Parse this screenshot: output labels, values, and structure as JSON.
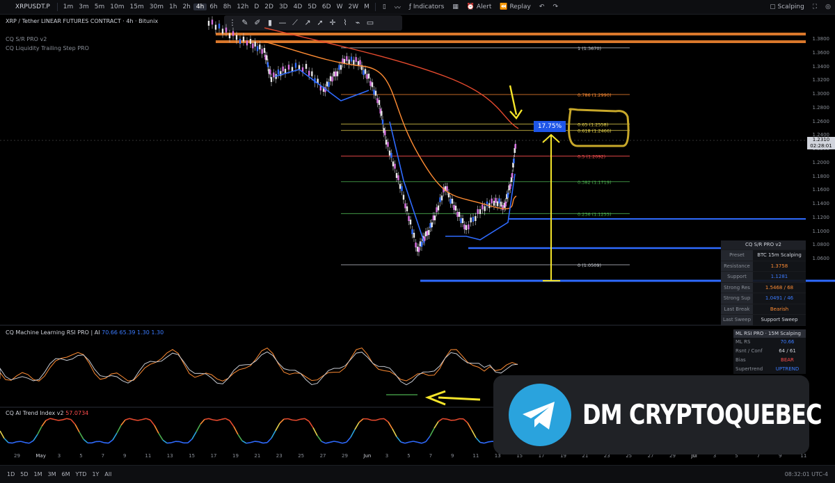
{
  "toolbar": {
    "symbol": "XRPUSDT.P",
    "timeframes": [
      "1m",
      "3m",
      "5m",
      "10m",
      "15m",
      "30m",
      "1h",
      "2h",
      "4h",
      "6h",
      "8h",
      "12h",
      "D",
      "2D",
      "3D",
      "4D",
      "5D",
      "6D",
      "W",
      "2W",
      "M"
    ],
    "active_timeframe": "4h",
    "indicators_label": "Indicators",
    "alert_label": "Alert",
    "replay_label": "Replay",
    "layout_label": "Scalping"
  },
  "legend": {
    "title": "XRP / Tether LINEAR FUTURES CONTRACT · 4h · Bitunix",
    "line2": "CQ S/R PRO v2",
    "line3": "CQ Liquidity Trailing Step PRO"
  },
  "price_axis": {
    "labels": [
      "1.3800",
      "1.3600",
      "1.3400",
      "1.3200",
      "1.3000",
      "1.2800",
      "1.2600",
      "1.2400",
      "1.2200",
      "1.2000",
      "1.1800",
      "1.1600",
      "1.1400",
      "1.1200",
      "1.1000",
      "1.0800",
      "1.0600"
    ],
    "current_price": "1.2310",
    "current_time": "02:28:01"
  },
  "fib_levels": [
    {
      "label": "1 (1.3670)",
      "price": 1.367
    },
    {
      "label": "0.786 (1.2990)",
      "price": 1.299
    },
    {
      "label": "0.65 (1.2558)",
      "price": 1.2558
    },
    {
      "label": "0.618 (1.2466)",
      "price": 1.2466
    },
    {
      "label": "0.5 (1.2092)",
      "price": 1.2092
    },
    {
      "label": "0.382 (1.1719)",
      "price": 1.1719
    },
    {
      "label": "0.236 (1.1255)",
      "price": 1.1255
    },
    {
      "label": "0 (1.0509)",
      "price": 1.0509
    }
  ],
  "percent_label": "17.75%",
  "sr_table": {
    "title": "CQ S/R PRO v2",
    "rows": [
      {
        "k": "Preset",
        "v": "BTC 15m Scalping",
        "color": "#d1d4dc"
      },
      {
        "k": "Resistance",
        "v": "1.3758",
        "color": "#ff8c33"
      },
      {
        "k": "Support",
        "v": "1.1281",
        "color": "#3b7bff"
      },
      {
        "k": "Strong Res",
        "v": "1.5468 / 68",
        "color": "#ff8c33"
      },
      {
        "k": "Strong Sup",
        "v": "1.0491 / 46",
        "color": "#3b7bff"
      },
      {
        "k": "Last Break",
        "v": "Bearish",
        "color": "#ff8c33"
      },
      {
        "k": "Last Sweep",
        "v": "Support Sweep",
        "color": "#d1d4dc"
      }
    ]
  },
  "rsi_panel": {
    "title": "CQ Machine Learning RSI PRO | AI",
    "values": "70.66  65.39  1.30  1.30",
    "table_title": "ML RSI PRO · 15M Scalping",
    "rows": [
      {
        "k": "ML RS",
        "v": "70.66",
        "color": "#3b7bff"
      },
      {
        "k": "Rsnt / Conf",
        "v": "64 / 61",
        "color": "#d1d4dc"
      },
      {
        "k": "Bias",
        "v": "BEAR",
        "color": "#ff4d4d"
      },
      {
        "k": "Supertrend",
        "v": "UPTREND",
        "color": "#3b7bff"
      }
    ],
    "axis": [
      "80.00",
      "60.00"
    ]
  },
  "trend_panel": {
    "title": "CQ AI Trend Index v2",
    "value": "57.0734"
  },
  "date_axis": [
    "29",
    "May",
    "3",
    "5",
    "7",
    "9",
    "11",
    "13",
    "15",
    "17",
    "19",
    "21",
    "23",
    "25",
    "27",
    "29",
    "Jun",
    "3",
    "5",
    "7",
    "9",
    "11",
    "13",
    "15",
    "17",
    "19",
    "21",
    "23",
    "25",
    "27",
    "29",
    "Jul",
    "3",
    "5",
    "7",
    "9",
    "11"
  ],
  "ranges": [
    "1D",
    "5D",
    "1M",
    "3M",
    "6M",
    "YTD",
    "1Y",
    "All"
  ],
  "clock": "08:32:01 UTC-4",
  "promo_text": "DM CRYPTOQUEBEC",
  "colors": {
    "accent": "#1e56e8",
    "arrow": "#f5e52a",
    "orange": "#ff8c33",
    "blue": "#3b7bff",
    "telegram": "#2aa3dd"
  }
}
